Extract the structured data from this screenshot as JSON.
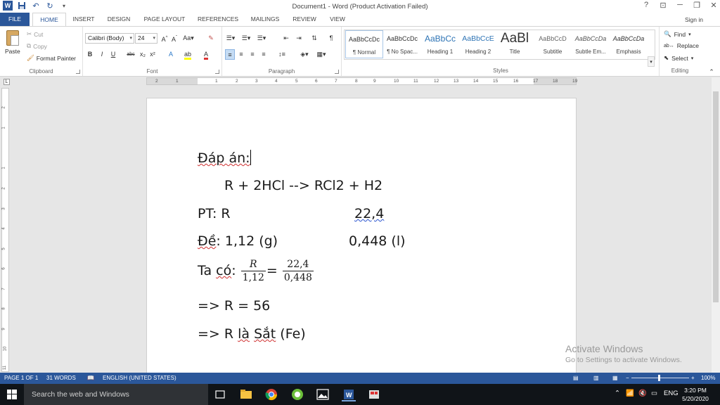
{
  "window": {
    "title": "Document1 - Word (Product Activation Failed)",
    "controls": [
      "?",
      "⊡",
      "─",
      "❐",
      "✕"
    ]
  },
  "tabs": {
    "file": "FILE",
    "items": [
      "HOME",
      "INSERT",
      "DESIGN",
      "PAGE LAYOUT",
      "REFERENCES",
      "MAILINGS",
      "REVIEW",
      "VIEW"
    ],
    "active": "HOME",
    "sign_in": "Sign in"
  },
  "ribbon": {
    "clipboard": {
      "paste": "Paste",
      "cut": "Cut",
      "copy": "Copy",
      "format_painter": "Format Painter",
      "label": "Clipboard"
    },
    "font": {
      "font_name": "Calibri (Body)",
      "font_size": "24",
      "label": "Font"
    },
    "paragraph": {
      "label": "Paragraph"
    },
    "styles": {
      "label": "Styles",
      "items": [
        {
          "sample": "AaBbCcDc",
          "name": "¶ Normal"
        },
        {
          "sample": "AaBbCcDc",
          "name": "¶ No Spac..."
        },
        {
          "sample": "AaBbCc",
          "name": "Heading 1"
        },
        {
          "sample": "AaBbCcE",
          "name": "Heading 2"
        },
        {
          "sample": "AaBl",
          "name": "Title"
        },
        {
          "sample": "AaBbCcD",
          "name": "Subtitle"
        },
        {
          "sample": "AaBbCcDa",
          "name": "Subtle Em..."
        },
        {
          "sample": "AaBbCcDa",
          "name": "Emphasis"
        }
      ]
    },
    "editing": {
      "find": "Find",
      "replace": "Replace",
      "select": "Select",
      "label": "Editing"
    }
  },
  "ruler": {
    "ticks": [
      "2",
      "1",
      "1",
      "2",
      "3",
      "4",
      "5",
      "6",
      "7",
      "8",
      "9",
      "10",
      "11",
      "12",
      "13",
      "14",
      "15",
      "16",
      "17",
      "18",
      "19"
    ],
    "vticks": [
      "2",
      "1",
      "1",
      "2",
      "3",
      "4",
      "5",
      "6",
      "7",
      "8",
      "9",
      "10",
      "11"
    ]
  },
  "document": {
    "line1": "Đáp án:",
    "line2": "R + 2HCl --> RCl2 + H2",
    "line3_left": "PT:  R",
    "line3_right": "22,4",
    "line4_prefix": "Đề",
    "line4_value": ": 1,12 (g)",
    "line4_right": "0,448 (l)",
    "line5_prefix": "Ta ",
    "line5_co": "có",
    "line5_colon": ":",
    "frac1_num": "R",
    "frac1_den": "1,12",
    "equals": "=",
    "frac2_num": "22,4",
    "frac2_den": "0,448",
    "line6": "=> R = 56",
    "line7_a": "=> R ",
    "line7_la": "là",
    "line7_b": " ",
    "line7_sat": "Sắt",
    "line7_c": " (Fe)"
  },
  "watermark": {
    "title": "Activate Windows",
    "subtitle": "Go to Settings to activate Windows."
  },
  "statusbar": {
    "page": "PAGE 1 OF 1",
    "words": "31 WORDS",
    "language": "ENGLISH (UNITED STATES)",
    "zoom": "100%"
  },
  "taskbar": {
    "search_placeholder": "Search the web and Windows",
    "lang": "ENG",
    "time": "3:20 PM",
    "date": "5/20/2020"
  },
  "colors": {
    "accent": "#2b579a",
    "taskbar": "#101418"
  }
}
